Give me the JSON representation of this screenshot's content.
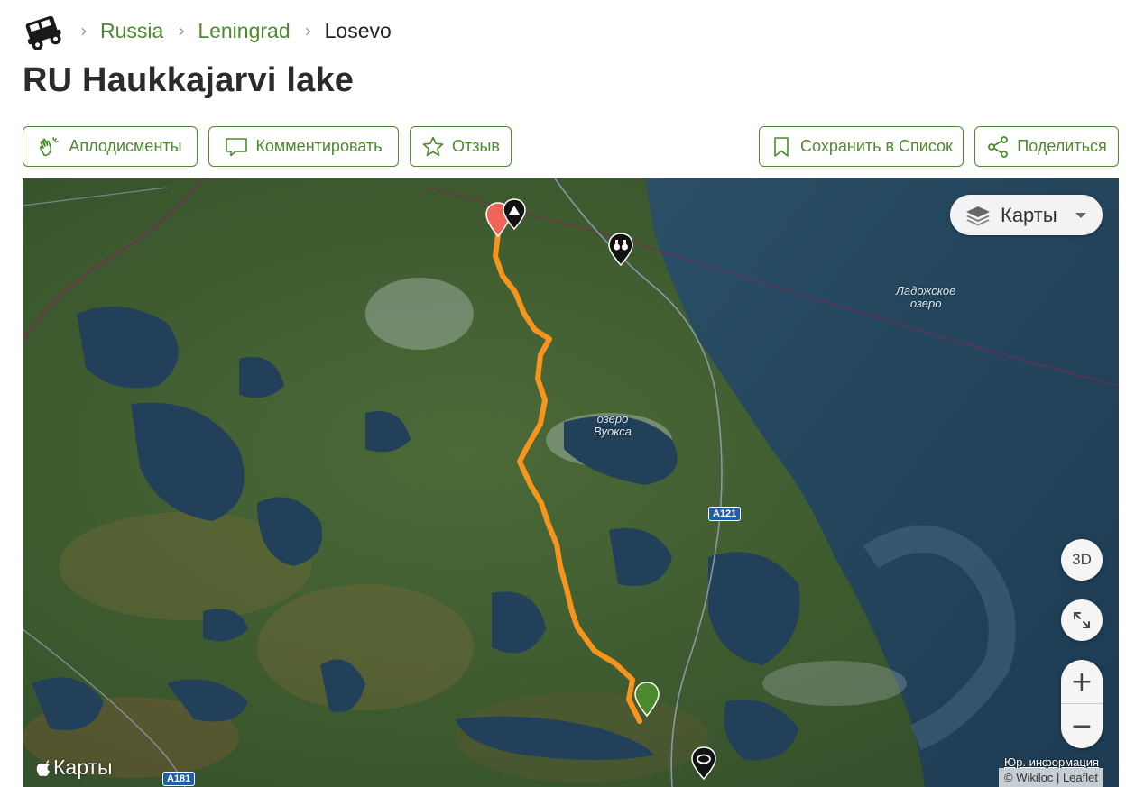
{
  "breadcrumb": {
    "logo_icon": "jeep-logo-icon",
    "items": [
      {
        "label": "Russia"
      },
      {
        "label": "Leningrad"
      }
    ],
    "current": "Losevo"
  },
  "title": "RU Haukkajarvi lake",
  "actions": {
    "applause": "Аплодисменты",
    "comment": "Комментировать",
    "review": "Отзыв",
    "save": "Сохранить в Список",
    "share": "Поделиться"
  },
  "map": {
    "layers_label": "Карты",
    "btn_3d": "3D",
    "zoom_in": "+",
    "zoom_out": "−",
    "brand": "Карты",
    "legal": "Юр. информация",
    "attribution": "© Wikiloc | Leaflet",
    "labels": {
      "lake_ladoga": [
        "Ладожское",
        "озеро"
      ],
      "lake_vuoksa": [
        "озеро",
        "Вуокса"
      ]
    },
    "roads": {
      "a121": "A121",
      "a181": "A181"
    },
    "colors": {
      "route": "#f7941d",
      "start_marker": "#4c8a2e",
      "end_marker": "#f0645a",
      "accent": "#4c8a2e"
    }
  }
}
